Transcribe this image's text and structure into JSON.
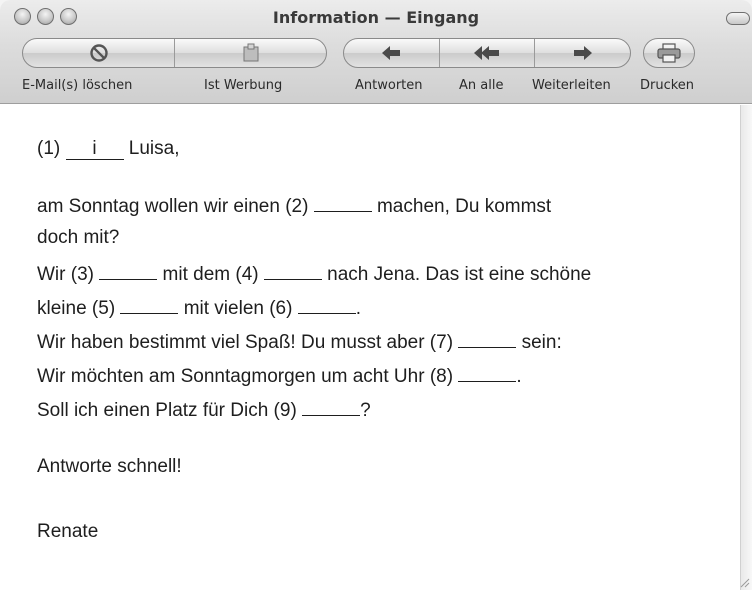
{
  "window": {
    "title": "Information — Eingang"
  },
  "toolbar": {
    "delete_label": "E-Mail(s) löschen",
    "junk_label": "Ist Werbung",
    "reply_label": "Antworten",
    "reply_all_label": "An alle",
    "forward_label": "Weiterleiten",
    "print_label": "Drucken"
  },
  "message": {
    "greeting": {
      "before": "(1) ",
      "blank": "i",
      "after": " Luisa,"
    },
    "line1": {
      "a": "am Sonntag wollen wir einen (2) ",
      "b": " machen, Du kommst"
    },
    "line2": "doch mit?",
    "line3": {
      "a": "Wir (3) ",
      "b": " mit dem (4) ",
      "c": " nach Jena. Das ist eine schöne"
    },
    "line4": {
      "a": "kleine (5) ",
      "b": " mit vielen (6) ",
      "c": "."
    },
    "line5": {
      "a": "Wir haben bestimmt viel Spaß! Du musst aber (7) ",
      "b": " sein:"
    },
    "line6": {
      "a": "Wir möchten am Sonntagmorgen um acht Uhr (8) ",
      "b": "."
    },
    "line7": {
      "a": "Soll ich einen Platz für Dich (9) ",
      "b": "?"
    },
    "closing": "Antworte schnell!",
    "signature": "Renate"
  }
}
